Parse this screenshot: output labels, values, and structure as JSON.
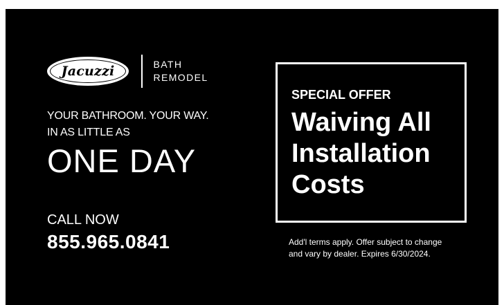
{
  "brand": {
    "logo_text": "Jacuzzi",
    "sub_line1": "BATH",
    "sub_line2": "REMODEL"
  },
  "tagline": {
    "line1": "YOUR BATHROOM.  YOUR WAY.",
    "line2": "IN AS LITTLE AS"
  },
  "headline": "ONE DAY",
  "cta": {
    "label": "CALL NOW",
    "phone": "855.965.0841"
  },
  "offer": {
    "kicker": "SPECIAL OFFER",
    "line1": "Waiving All",
    "line2": "Installation",
    "line3": "Costs"
  },
  "disclaimer": {
    "line1": "Add'l terms apply. Offer subject to change",
    "line2": "and vary by dealer. Expires 6/30/2024."
  },
  "colors": {
    "background": "#000000",
    "text": "#ffffff"
  }
}
